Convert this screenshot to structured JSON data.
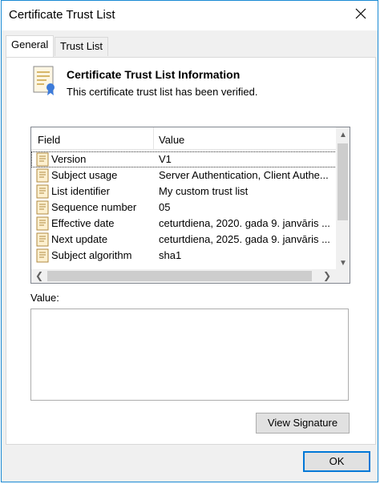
{
  "window": {
    "title": "Certificate Trust List",
    "close_icon": "close-icon"
  },
  "tabs": [
    {
      "label": "General",
      "active": true
    },
    {
      "label": "Trust List",
      "active": false
    }
  ],
  "info": {
    "heading": "Certificate Trust List Information",
    "subtext": "This certificate trust list has been verified."
  },
  "fields_list": {
    "columns": [
      "Field",
      "Value"
    ],
    "rows": [
      {
        "field": "Version",
        "value": "V1"
      },
      {
        "field": "Subject usage",
        "value": "Server Authentication, Client Authe..."
      },
      {
        "field": "List identifier",
        "value": "My custom trust list"
      },
      {
        "field": "Sequence number",
        "value": "05"
      },
      {
        "field": "Effective date",
        "value": "ceturtdiena, 2020. gada 9. janvāris ..."
      },
      {
        "field": "Next update",
        "value": "ceturtdiena, 2025. gada 9. janvāris ..."
      },
      {
        "field": "Subject algorithm",
        "value": "sha1"
      }
    ]
  },
  "value_label": "Value:",
  "value_text": "",
  "buttons": {
    "view_signature": "View Signature",
    "ok": "OK"
  }
}
